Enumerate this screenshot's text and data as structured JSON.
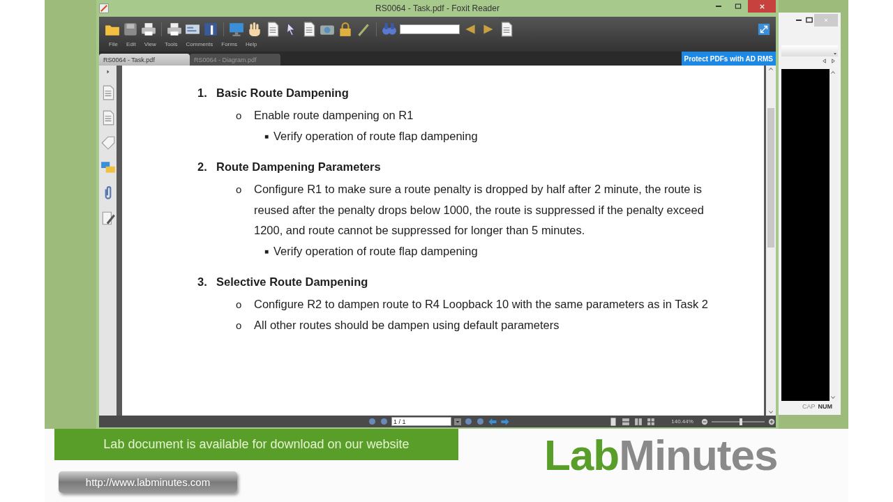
{
  "window": {
    "title": "RS0064 - Task.pdf - Foxit Reader",
    "menu": [
      "File",
      "Edit",
      "View",
      "Tools",
      "Comments",
      "Forms",
      "Help"
    ],
    "tabs": [
      {
        "label": "RS0064 - Task.pdf",
        "selected": true
      },
      {
        "label": "RS0064 - Diagram.pdf",
        "selected": false
      }
    ],
    "promo": "Protect PDFs with AD RMS"
  },
  "document": {
    "sections": [
      {
        "number": "1.",
        "heading": "Basic Route Dampening",
        "items": [
          {
            "bullet": "o",
            "text": "Enable route dampening on R1",
            "children": [
              {
                "bullet": "■",
                "text": "Verify operation of route flap dampening"
              }
            ]
          }
        ]
      },
      {
        "number": "2.",
        "heading": "Route Dampening Parameters",
        "items": [
          {
            "bullet": "o",
            "text": "Configure R1 to make sure a route penalty is dropped by half after 2 minute, the route is reused after the penalty drops below 1000, the route is suppressed if the penalty exceed 1200, and route cannot be suppressed for longer than 5 minutes.",
            "children": [
              {
                "bullet": "■",
                "text": "Verify operation of route flap dampening"
              }
            ]
          }
        ]
      },
      {
        "number": "3.",
        "heading": "Selective Route Dampening",
        "items": [
          {
            "bullet": "o",
            "text": "Configure R2 to dampen route to R4 Loopback 10 with the same parameters as in Task 2"
          },
          {
            "bullet": "o",
            "text": "All other routes should be dampen using default parameters"
          }
        ]
      }
    ]
  },
  "status_bar": {
    "page": "1 / 1",
    "zoom": "140.44%",
    "zoom_slider": {
      "level": 0.55
    }
  },
  "second_window": {
    "status": [
      "CAP",
      "NUM"
    ]
  },
  "overlay": {
    "banner": "Lab document is available for download on our website",
    "url": "http://www.labminutes.com",
    "logo": {
      "first": "Lab",
      "second": "Minutes"
    }
  }
}
